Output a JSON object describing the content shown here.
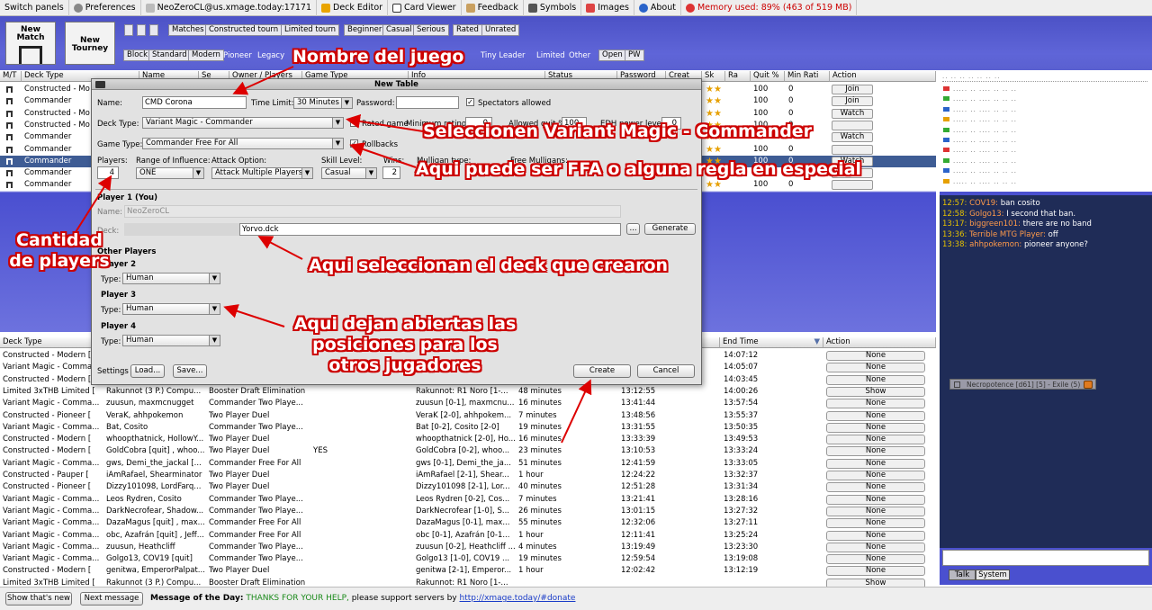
{
  "menu": {
    "items": [
      "Switch panels",
      "Preferences",
      "NeoZeroCL@us.xmage.today:17171",
      "Deck Editor",
      "Card Viewer",
      "Feedback",
      "Symbols",
      "Images",
      "About"
    ],
    "memory": "Memory used: 89% (463 of 519 MB)"
  },
  "toolbar": {
    "new_match": "New Match",
    "new_tourney": "New Tourney",
    "filters1": [
      "Matches",
      "Constructed tourn",
      "Limited tourn",
      "Beginner",
      "Casual",
      "Serious",
      "Rated",
      "Unrated"
    ],
    "filters2": [
      "Block",
      "Standard",
      "Modern",
      "Pioneer",
      "Legacy"
    ],
    "filters2b": [
      "Tiny Leader",
      "Limited",
      "Other",
      "Open",
      "PW"
    ]
  },
  "upper_table": {
    "headers": [
      "M/T",
      "Deck Type",
      "Name",
      "Se",
      "Owner / Players",
      "Game Type",
      "Info",
      "Status",
      "Password",
      "Creat",
      "Sk",
      "Ra",
      "Quit %",
      "Min Rati",
      "Action"
    ],
    "rows": [
      {
        "deck": "Constructed - Mo",
        "quit": "100",
        "rating": "0",
        "action": "Join"
      },
      {
        "deck": "Commander",
        "quit": "100",
        "rating": "0",
        "action": "Join"
      },
      {
        "deck": "Constructed - Mo",
        "quit": "100",
        "rating": "0",
        "action": "Watch"
      },
      {
        "deck": "Constructed - Mo",
        "quit": "100",
        "rating": "0",
        "action": ""
      },
      {
        "deck": "Commander",
        "quit": "100",
        "rating": "0",
        "action": "Watch"
      },
      {
        "deck": "Commander",
        "quit": "100",
        "rating": "0",
        "action": ""
      },
      {
        "deck": "Commander",
        "quit": "100",
        "rating": "0",
        "action": "Watch"
      },
      {
        "deck": "Commander",
        "quit": "100",
        "rating": "0",
        "action": ""
      },
      {
        "deck": "Commander",
        "quit": "100",
        "rating": "0",
        "action": ""
      }
    ]
  },
  "lower_table": {
    "headers": [
      "Deck Type",
      "End Time",
      "Action"
    ],
    "rows": [
      {
        "deck": "Constructed - Modern [",
        "name": "",
        "game": "",
        "info": "",
        "dur": "",
        "start": "",
        "end": "14:07:12",
        "action": "None"
      },
      {
        "deck": "Variant Magic - Comma",
        "name": "",
        "game": "",
        "info": "",
        "dur": "",
        "start": "",
        "end": "14:05:07",
        "action": "None"
      },
      {
        "deck": "Constructed - Modern [",
        "name": "",
        "game": "",
        "info": "",
        "dur": "",
        "start": "",
        "end": "14:03:45",
        "action": "None"
      },
      {
        "deck": "Limited 3xTHB Limited [",
        "name": "Rakunnot (3 P.) Compu...",
        "game": "Booster Draft Elimination",
        "info": "Rakunnot: R1 Noro [1-...",
        "dur": "48 minutes",
        "start": "13:12:55",
        "end": "14:00:26",
        "action": "Show"
      },
      {
        "deck": "Variant Magic - Comma...",
        "name": "zuusun, maxmcnugget",
        "game": "Commander Two Playe...",
        "info": "zuusun [0-1], maxmcnu...",
        "dur": "16 minutes",
        "start": "13:41:44",
        "end": "13:57:54",
        "action": "None"
      },
      {
        "deck": "Constructed - Pioneer [",
        "name": "VeraK, ahhpokemon",
        "game": "Two Player Duel",
        "info": "VeraK [2-0], ahhpokem...",
        "dur": "7 minutes",
        "start": "13:48:56",
        "end": "13:55:37",
        "action": "None"
      },
      {
        "deck": "Variant Magic - Comma...",
        "name": "Bat, Cosito",
        "game": "Commander Two Playe...",
        "info": "Bat [0-2], Cosito [2-0]",
        "dur": "19 minutes",
        "start": "13:31:55",
        "end": "13:50:35",
        "action": "None"
      },
      {
        "deck": "Constructed - Modern [",
        "name": "whoopthatnick, HollowY...",
        "game": "Two Player Duel",
        "info": "whoopthatnick [2-0], Ho...",
        "dur": "16 minutes",
        "start": "13:33:39",
        "end": "13:49:53",
        "action": "None"
      },
      {
        "deck": "Constructed - Modern [",
        "name": "GoldCobra [quit] , whoo...",
        "game": "Two Player Duel",
        "sp": "YES",
        "info": "GoldCobra [0-2], whoo...",
        "dur": "23 minutes",
        "start": "13:10:53",
        "end": "13:33:24",
        "action": "None"
      },
      {
        "deck": "Variant Magic - Comma...",
        "name": "gws, Demi_the_jackal [...",
        "game": "Commander Free For All",
        "info": "gws [0-1], Demi_the_ja...",
        "dur": "51 minutes",
        "start": "12:41:59",
        "end": "13:33:05",
        "action": "None"
      },
      {
        "deck": "Constructed - Pauper [",
        "name": "iAmRafael, Shearminator",
        "game": "Two Player Duel",
        "info": "iAmRafael [2-1], Shear...",
        "dur": "1 hour",
        "start": "12:24:22",
        "end": "13:32:37",
        "action": "None"
      },
      {
        "deck": "Constructed - Pioneer [",
        "name": "Dizzy101098, LordFarq...",
        "game": "Two Player Duel",
        "info": "Dizzy101098 [2-1], Lor...",
        "dur": "40 minutes",
        "start": "12:51:28",
        "end": "13:31:34",
        "action": "None"
      },
      {
        "deck": "Variant Magic - Comma...",
        "name": "Leos Rydren, Cosito",
        "game": "Commander Two Playe...",
        "info": "Leos Rydren [0-2], Cos...",
        "dur": "7 minutes",
        "start": "13:21:41",
        "end": "13:28:16",
        "action": "None"
      },
      {
        "deck": "Variant Magic - Comma...",
        "name": "DarkNecrofear, Shadow...",
        "game": "Commander Two Playe...",
        "info": "DarkNecrofear [1-0], S...",
        "dur": "26 minutes",
        "start": "13:01:15",
        "end": "13:27:32",
        "action": "None"
      },
      {
        "deck": "Variant Magic - Comma...",
        "name": "DazaMagus [quit] , max...",
        "game": "Commander Free For All",
        "info": "DazaMagus [0-1], max...",
        "dur": "55 minutes",
        "start": "12:32:06",
        "end": "13:27:11",
        "action": "None"
      },
      {
        "deck": "Variant Magic - Comma...",
        "name": "obc, Azafrán [quit] , Jeff...",
        "game": "Commander Free For All",
        "info": "obc [0-1], Azafrán [0-1...",
        "dur": "1 hour",
        "start": "12:11:41",
        "end": "13:25:24",
        "action": "None"
      },
      {
        "deck": "Variant Magic - Comma...",
        "name": "zuusun, Heathcliff",
        "game": "Commander Two Playe...",
        "info": "zuusun [0-2], Heathcliff ...",
        "dur": "4 minutes",
        "start": "13:19:49",
        "end": "13:23:30",
        "action": "None"
      },
      {
        "deck": "Variant Magic - Comma...",
        "name": "Golgo13, COV19 [quit]",
        "game": "Commander Two Playe...",
        "info": "Golgo13 [1-0], COV19 ...",
        "dur": "19 minutes",
        "start": "12:59:54",
        "end": "13:19:08",
        "action": "None"
      },
      {
        "deck": "Constructed - Modern [",
        "name": "genitwa, EmperorPalpat...",
        "game": "Two Player Duel",
        "info": "genitwa [2-1], Emperor...",
        "dur": "1 hour",
        "start": "12:02:42",
        "end": "13:12:19",
        "action": "None"
      },
      {
        "deck": "Limited 3xTHB Limited [",
        "name": "Rakunnot (3 P.) Compu...",
        "game": "Booster Draft Elimination",
        "info": "Rakunnot: R1 Noro [1-...",
        "dur": "",
        "start": "",
        "end": "",
        "action": "Show"
      }
    ]
  },
  "chat": {
    "lines": [
      {
        "time": "12:57:",
        "user": "COV19:",
        "msg": "ban cosito"
      },
      {
        "time": "12:58:",
        "user": "Golgo13:",
        "msg": "I second that ban."
      },
      {
        "time": "13:17:",
        "user": "biggreen101:",
        "msg": "there are no band"
      },
      {
        "time": "13:36:",
        "user": "Terrible MTG Player:",
        "msg": "off"
      },
      {
        "time": "13:38:",
        "user": "ahhpokemon:",
        "msg": "pioneer anyone?"
      }
    ],
    "tabs": [
      "Talk",
      "System"
    ],
    "floating": "Necropotence [d61] [5] - Exile (5)"
  },
  "bottom": {
    "btn1": "Show that's new",
    "btn2": "Next message",
    "motd_label": "Message of the Day:",
    "motd_green": "THANKS FOR YOUR HELP,",
    "motd_rest": "please support servers by",
    "motd_link": "http://xmage.today/#donate"
  },
  "dialog": {
    "title": "New Table",
    "name_label": "Name:",
    "name_value": "CMD Corona",
    "time_label": "Time Limit:",
    "time_value": "30 Minutes",
    "pw_label": "Password:",
    "spect_label": "Spectators allowed",
    "deck_type_label": "Deck Type:",
    "deck_type_value": "Variant Magic - Commander",
    "rated_label": "Rated game",
    "minrating_label": "Minimum rating",
    "minrating_value": "0",
    "quit_label": "Allowed quit %",
    "quit_value": "100",
    "edh_label": "EDH power level",
    "edh_value": "0",
    "game_type_label": "Game Type:",
    "game_type_value": "Commander Free For All",
    "rollbacks_label": "Rollbacks",
    "players_label": "Players:",
    "players_value": "4",
    "range_label": "Range of Influence:",
    "range_value": "ONE",
    "attack_label": "Attack Option:",
    "attack_value": "Attack Multiple Players",
    "skill_label": "Skill Level:",
    "skill_value": "Casual",
    "wins_label": "Wins:",
    "wins_value": "2",
    "mulligan_label": "Mulligan type:",
    "free_label": "Free Mulligans:",
    "player1_label": "Player 1 (You)",
    "p1name_label": "Name:",
    "p1name_value": "NeoZeroCL",
    "deck_label": "Deck:",
    "deck_value": "Yorvo.dck",
    "generate": "Generate",
    "browse": "...",
    "other_label": "Other Players",
    "p2_label": "Player 2",
    "p3_label": "Player 3",
    "p4_label": "Player 4",
    "type_label": "Type:",
    "type_value": "Human",
    "settings_label": "Settings",
    "load": "Load...",
    "save": "Save...",
    "create": "Create",
    "cancel": "Cancel"
  },
  "annotations": {
    "a1": "Nombre del juego",
    "a2": "Seleccionen Variant Magic - Commander",
    "a3": "Aqui puede ser FFA o alguna regla en especial",
    "a4": "Cantidad de players",
    "a5": "Aqui seleccionan el deck que crearon",
    "a6": "Aqui dejan abiertas las posiciones para los otros jugadores"
  }
}
